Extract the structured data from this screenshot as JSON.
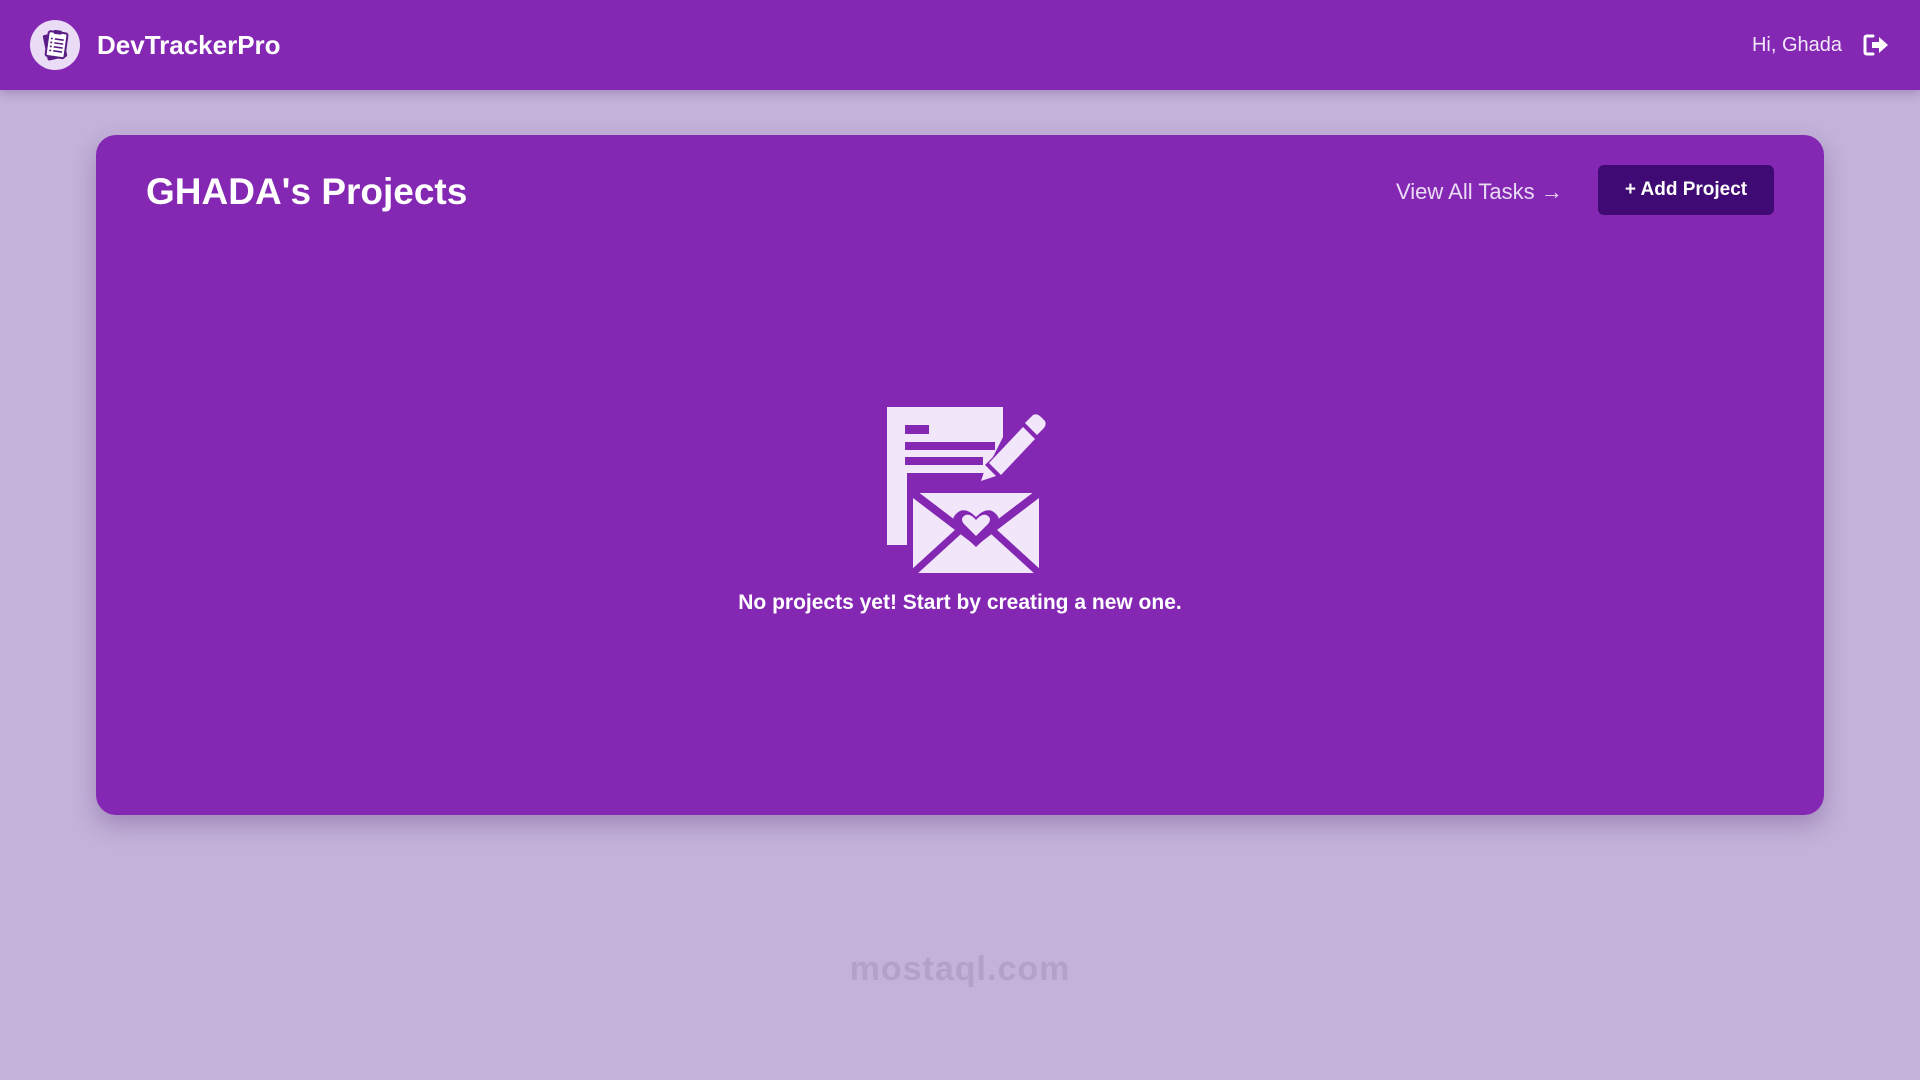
{
  "navbar": {
    "app_name": "DevTrackerPro",
    "greeting": "Hi, Ghada",
    "logo_icon": "clipboard-checklist-icon",
    "logout_icon": "sign-out-icon"
  },
  "projects_panel": {
    "title": "GHADA's Projects",
    "view_all_label": "View All Tasks →",
    "add_button_label": "+ Add Project",
    "empty_icon": "document-with-pencil-and-heart-envelope-icon",
    "empty_message": "No projects yet! Start by creating a new one."
  },
  "watermark": {
    "text": "mostaql.com"
  },
  "colors": {
    "page_background": "#c3b2d9",
    "navbar": "#8428b4",
    "panel": "#8428b4",
    "button": "#3f0a73",
    "text_light": "#ffffff"
  }
}
